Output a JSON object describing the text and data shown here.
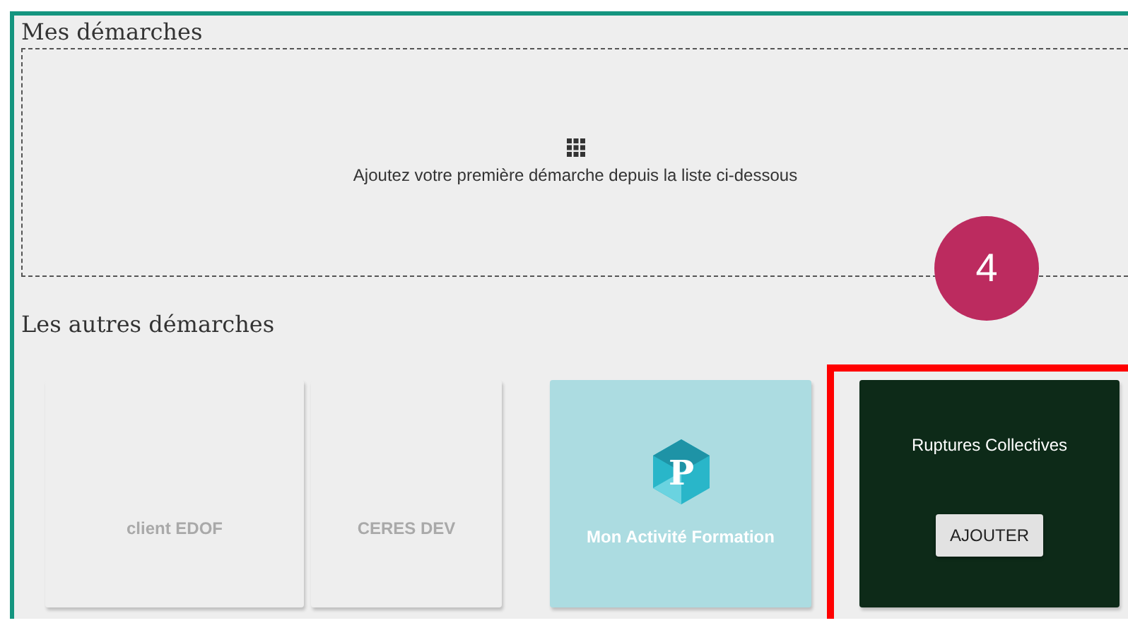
{
  "my_section": {
    "title": "Mes démarches",
    "empty_message": "Ajoutez votre première démarche depuis la liste ci-dessous"
  },
  "others_section": {
    "title": "Les autres démarches"
  },
  "cards": [
    {
      "kind": "plain",
      "title": "client EDOF"
    },
    {
      "kind": "plain",
      "title": "CERES DEV"
    },
    {
      "kind": "logo",
      "title": "Mon Activité Formation",
      "logo_letter": "P",
      "color": "#acdce1"
    },
    {
      "kind": "hover",
      "title": "Ruptures Collectives",
      "button": "AJOUTER",
      "color": "#0d2a18",
      "highlighted": true
    }
  ],
  "step_badge": "4"
}
